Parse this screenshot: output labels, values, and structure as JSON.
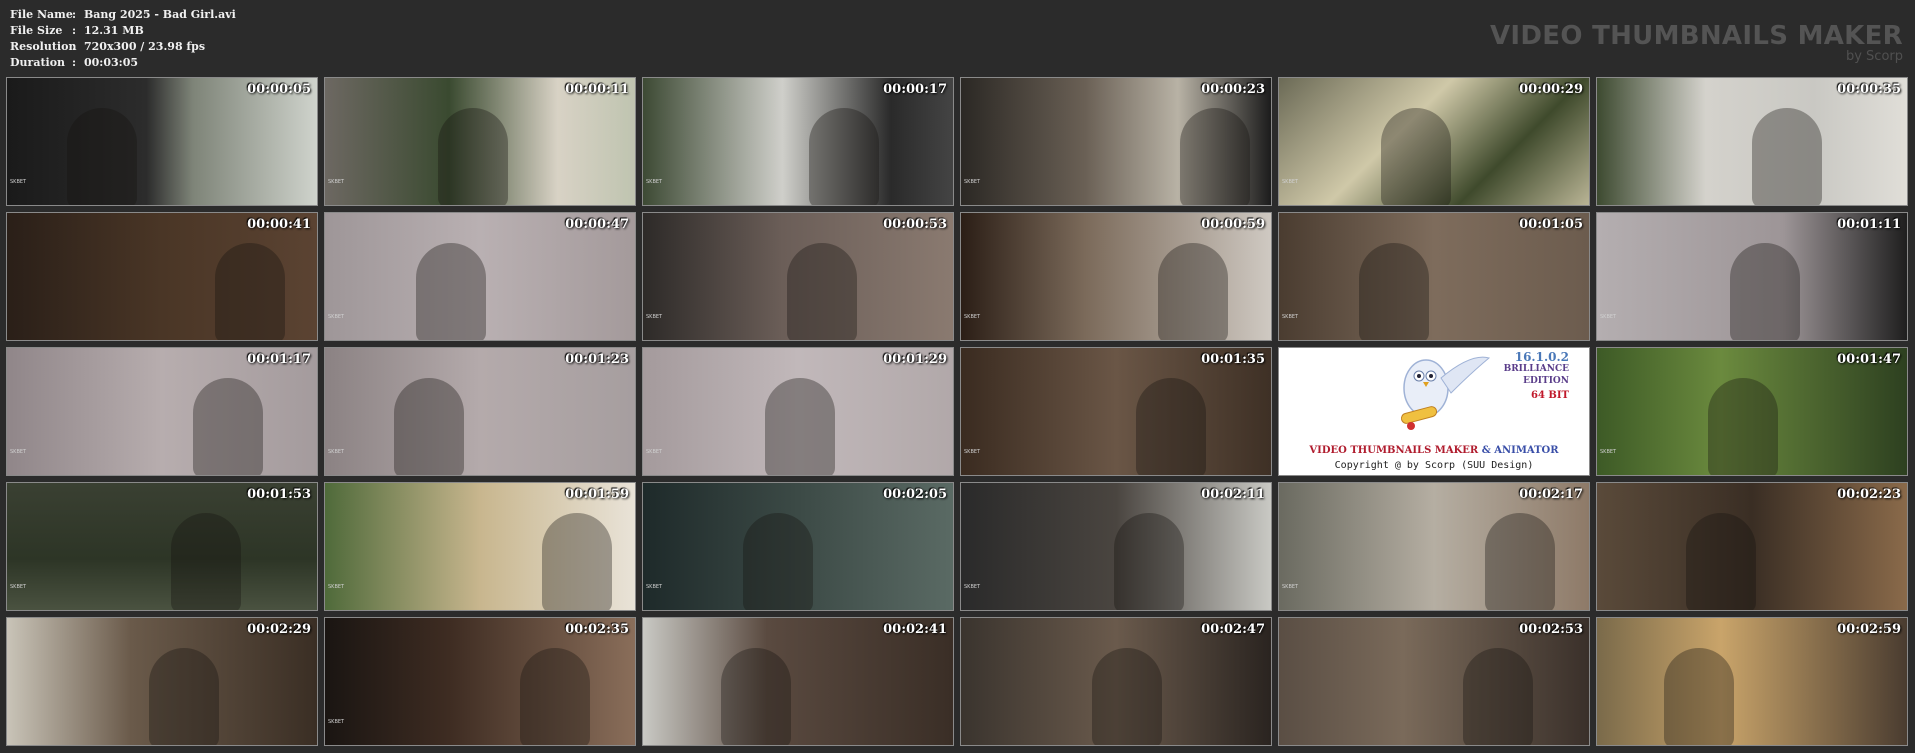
{
  "header": {
    "file_name_label": "File Name",
    "file_name": "Bang 2025 - Bad Girl.avi",
    "file_size_label": "File Size",
    "file_size": "12.31 MB",
    "resolution_label": "Resolution",
    "resolution": "720x300 / 23.98 fps",
    "duration_label": "Duration",
    "duration": "00:03:05",
    "separator": ":"
  },
  "brand": {
    "title": "VIDEO THUMBNAILS MAKER",
    "subtitle": "by Scorp"
  },
  "logo": {
    "version": "16.1.0.2",
    "edition_line1": "BRILLIANCE",
    "edition_line2": "EDITION",
    "bits": "64 BIT",
    "product_main": "VIDEO THUMBNAILS MAKER",
    "product_amp": " & ANIMATOR",
    "copyright": "Copyright @ by Scorp (SUU Design)"
  },
  "thumbnails": [
    {
      "timestamp": "00:00:05",
      "watermark": "SKBET"
    },
    {
      "timestamp": "00:00:11",
      "watermark": "SKBET"
    },
    {
      "timestamp": "00:00:17",
      "watermark": "SKBET"
    },
    {
      "timestamp": "00:00:23",
      "watermark": "SKBET"
    },
    {
      "timestamp": "00:00:29",
      "watermark": "SKBET"
    },
    {
      "timestamp": "00:00:35",
      "watermark": ""
    },
    {
      "timestamp": "00:00:41",
      "watermark": ""
    },
    {
      "timestamp": "00:00:47",
      "watermark": "SKBET"
    },
    {
      "timestamp": "00:00:53",
      "watermark": "SKBET"
    },
    {
      "timestamp": "00:00:59",
      "watermark": "SKBET"
    },
    {
      "timestamp": "00:01:05",
      "watermark": "SKBET"
    },
    {
      "timestamp": "00:01:11",
      "watermark": "SKBET"
    },
    {
      "timestamp": "00:01:17",
      "watermark": "SKBET"
    },
    {
      "timestamp": "00:01:23",
      "watermark": "SKBET"
    },
    {
      "timestamp": "00:01:29",
      "watermark": "SKBET"
    },
    {
      "timestamp": "00:01:35",
      "watermark": "SKBET"
    },
    {
      "timestamp": "",
      "watermark": "",
      "logo": true
    },
    {
      "timestamp": "00:01:47",
      "watermark": "SKBET"
    },
    {
      "timestamp": "00:01:53",
      "watermark": "SKBET"
    },
    {
      "timestamp": "00:01:59",
      "watermark": "SKBET"
    },
    {
      "timestamp": "00:02:05",
      "watermark": "SKBET"
    },
    {
      "timestamp": "00:02:11",
      "watermark": "SKBET"
    },
    {
      "timestamp": "00:02:17",
      "watermark": "SKBET"
    },
    {
      "timestamp": "00:02:23",
      "watermark": ""
    },
    {
      "timestamp": "00:02:29",
      "watermark": ""
    },
    {
      "timestamp": "00:02:35",
      "watermark": "SKBET"
    },
    {
      "timestamp": "00:02:41",
      "watermark": ""
    },
    {
      "timestamp": "00:02:47",
      "watermark": ""
    },
    {
      "timestamp": "00:02:53",
      "watermark": ""
    },
    {
      "timestamp": "00:02:59",
      "watermark": ""
    }
  ],
  "palette": {
    "background": "#2b2b2b",
    "brand_text": "#545454",
    "thumb_border": "#8a8a8a"
  }
}
